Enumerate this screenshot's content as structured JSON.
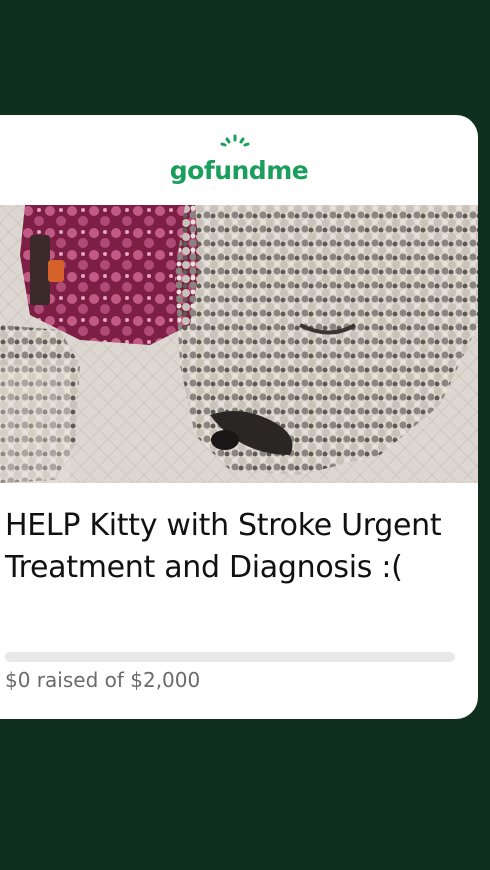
{
  "brand": {
    "logo_text": "gofundme",
    "logo_color": "#1a9e5b"
  },
  "campaign": {
    "image_alt": "dog-lying-on-mat-photo",
    "title": "HELP Kitty with Stroke Urgent Treatment and Diagnosis :(",
    "progress_fraction": 0,
    "raised_text": "$0 raised of $2,000"
  },
  "colors": {
    "background": "#10301f",
    "card": "#ffffff",
    "track": "#e8e8e8"
  }
}
